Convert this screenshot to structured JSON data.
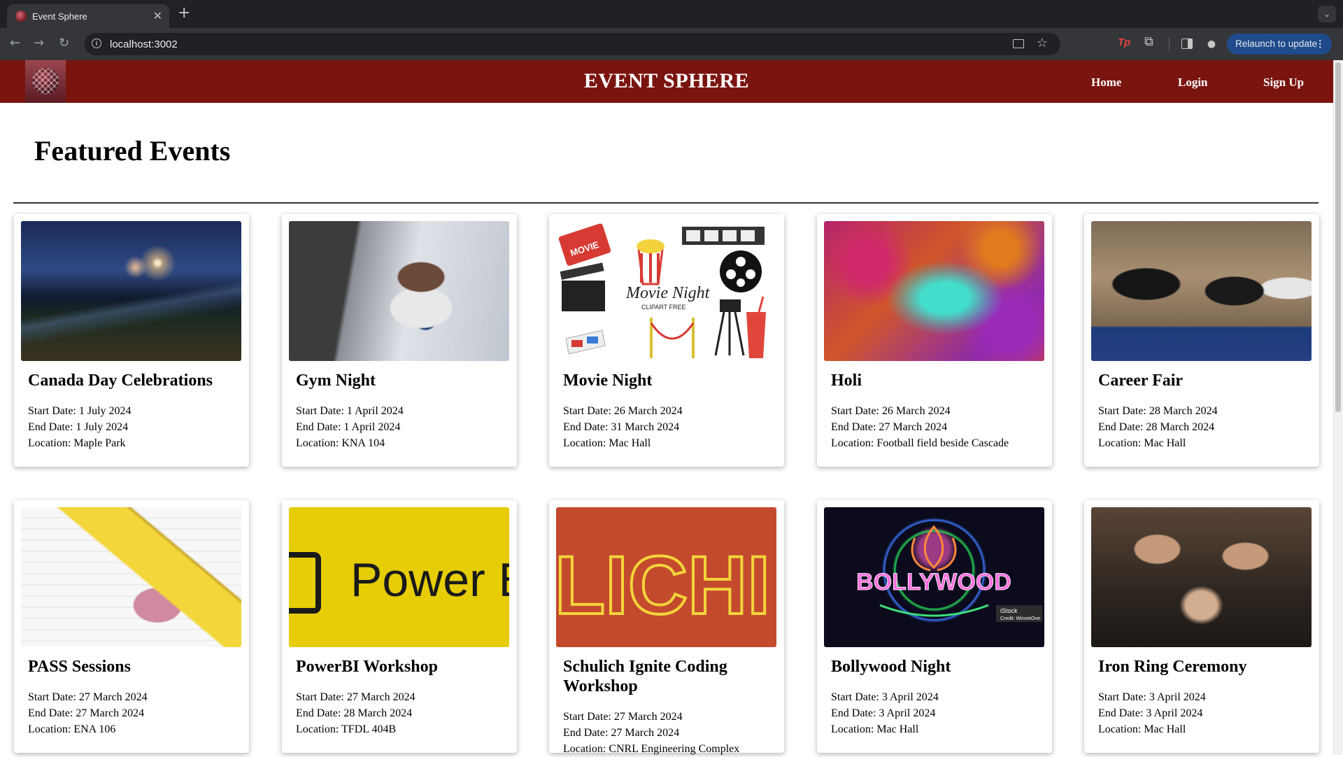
{
  "browser": {
    "tab_title": "Event Sphere",
    "url": "localhost:3002",
    "relaunch_label": "Relaunch to update",
    "extension_label": "Tp"
  },
  "app": {
    "title": "EVENT SPHERE",
    "nav": {
      "home": "Home",
      "login": "Login",
      "signup": "Sign Up"
    },
    "heading": "Featured Events"
  },
  "labels": {
    "start": "Start Date:",
    "end": "End Date:",
    "location": "Location:"
  },
  "events": [
    {
      "title": "Canada Day Celebrations",
      "start": "1 July 2024",
      "end": "1 July 2024",
      "location": "Maple Park"
    },
    {
      "title": "Gym Night",
      "start": "1 April 2024",
      "end": "1 April 2024",
      "location": "KNA 104"
    },
    {
      "title": "Movie Night",
      "start": "26 March 2024",
      "end": "31 March 2024",
      "location": "Mac Hall",
      "image_text": [
        "MOVIE",
        "Movie Night",
        "CLIPART FREE"
      ]
    },
    {
      "title": "Holi",
      "start": "26 March 2024",
      "end": "27 March 2024",
      "location": "Football field beside Cascade"
    },
    {
      "title": "Career Fair",
      "start": "28 March 2024",
      "end": "28 March 2024",
      "location": "Mac Hall"
    },
    {
      "title": "PASS Sessions",
      "start": "27 March 2024",
      "end": "27 March 2024",
      "location": "ENA 106"
    },
    {
      "title": "PowerBI Workshop",
      "start": "27 March 2024",
      "end": "28 March 2024",
      "location": "TFDL 404B",
      "image_text": [
        "Power B"
      ]
    },
    {
      "title": "Schulich Ignite Coding Workshop",
      "start": "27 March 2024",
      "end": "27 March 2024",
      "location": "CNRL Engineering Complex",
      "image_text": [
        "LICHI"
      ]
    },
    {
      "title": "Bollywood Night",
      "start": "3 April 2024",
      "end": "3 April 2024",
      "location": "Mac Hall",
      "image_text": [
        "BOLLYWOOD",
        "iStock",
        "Credit: WinnieOne"
      ]
    },
    {
      "title": "Iron Ring Ceremony",
      "start": "3 April 2024",
      "end": "3 April 2024",
      "location": "Mac Hall"
    }
  ],
  "colors": {
    "header_bg": "#7a140f",
    "browser_bg": "#202124",
    "relaunch_bg": "#1f4b8c"
  }
}
